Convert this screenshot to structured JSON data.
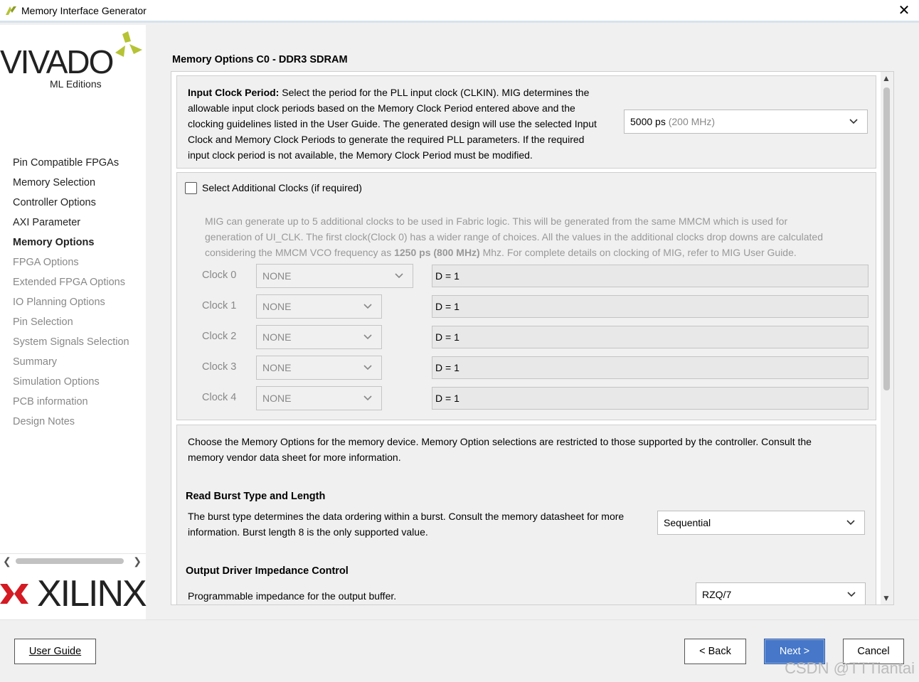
{
  "window": {
    "title": "Memory Interface Generator"
  },
  "branding": {
    "vivado": "VIVADO",
    "vivado_sub": "ML Editions",
    "xilinx": "XILINX",
    "accent": "#b5c334"
  },
  "sidebar": {
    "items": [
      {
        "label": "Pin Compatible FPGAs",
        "state": "done"
      },
      {
        "label": "Memory Selection",
        "state": "done"
      },
      {
        "label": "Controller Options",
        "state": "done"
      },
      {
        "label": "AXI Parameter",
        "state": "done"
      },
      {
        "label": "Memory Options",
        "state": "active"
      },
      {
        "label": "FPGA Options",
        "state": "pending"
      },
      {
        "label": "Extended FPGA Options",
        "state": "pending"
      },
      {
        "label": "IO Planning Options",
        "state": "pending"
      },
      {
        "label": "Pin Selection",
        "state": "pending"
      },
      {
        "label": "System Signals Selection",
        "state": "pending"
      },
      {
        "label": "Summary",
        "state": "pending"
      },
      {
        "label": "Simulation Options",
        "state": "pending"
      },
      {
        "label": "PCB information",
        "state": "pending"
      },
      {
        "label": "Design Notes",
        "state": "pending"
      }
    ]
  },
  "page": {
    "title": "Memory Options C0 - DDR3 SDRAM"
  },
  "input_clock": {
    "label": "Input Clock Period:",
    "lines": [
      " Select the period for the PLL input clock (CLKIN). MIG determines the",
      "allowable input clock periods based on the Memory Clock Period entered above and the",
      "clocking guidelines listed in the User Guide. The generated design will use the selected Input",
      "Clock and Memory Clock Periods to generate the required PLL parameters. If the required",
      "input clock period is not available, the Memory Clock Period must be modified."
    ],
    "value": "5000 ps",
    "value_hint": "(200 MHz)"
  },
  "additional_clocks": {
    "checkbox_label": "Select Additional Clocks (if required)",
    "checked": false,
    "desc_line1": "MIG can generate up to 5 additional clocks to be used in Fabric logic. This will be generated from the same MMCM which is used for",
    "desc_line2": "generation of UI_CLK. The first clock(Clock 0) has a wider range of choices. All the values in the additional clocks drop downs are calculated",
    "desc_line3_pre": "considering the MMCM VCO frequency as ",
    "desc_line3_bold": "1250 ps (800 MHz)",
    "desc_line3_post": " Mhz. For complete details on clocking of MIG, refer to MIG User Guide.",
    "clocks": [
      {
        "label": "Clock 0",
        "value": "NONE",
        "divider": "D = 1"
      },
      {
        "label": "Clock 1",
        "value": "NONE",
        "divider": "D = 1"
      },
      {
        "label": "Clock 2",
        "value": "NONE",
        "divider": "D = 1"
      },
      {
        "label": "Clock 3",
        "value": "NONE",
        "divider": "D = 1"
      },
      {
        "label": "Clock 4",
        "value": "NONE",
        "divider": "D = 1"
      }
    ]
  },
  "memory_options": {
    "intro_line1": "Choose the Memory Options for the memory device. Memory Option selections are restricted to those supported by the controller. Consult the",
    "intro_line2": "memory vendor data sheet for more information.",
    "burst": {
      "title": "Read Burst Type and Length",
      "line1": "The burst type determines the data ordering within a burst. Consult the memory datasheet for more",
      "line2": "information. Burst length 8 is the only supported value.",
      "value": "Sequential"
    },
    "odic": {
      "title": "Output Driver Impedance Control",
      "line1": "Programmable impedance for the output buffer.",
      "value": "RZQ/7"
    }
  },
  "footer": {
    "user_guide": "User Guide",
    "back": "< Back",
    "next": "Next >",
    "cancel": "Cancel",
    "watermark": "CSDN @TTTiantai"
  }
}
